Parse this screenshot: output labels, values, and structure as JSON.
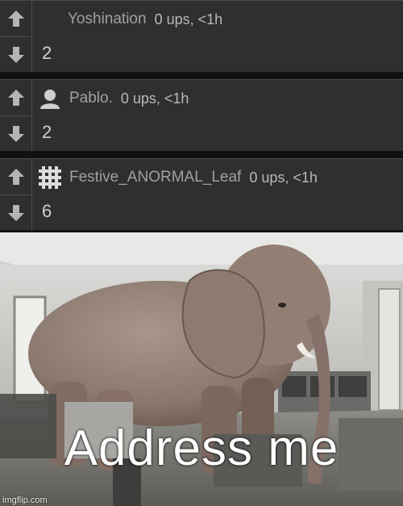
{
  "comments": [
    {
      "user": "Yoshination",
      "meta": "0 ups, <1h",
      "text": "2",
      "avatar": "none"
    },
    {
      "user": "Pablo.",
      "meta": "0 ups, <1h",
      "text": "2",
      "avatar": "default-person-icon"
    },
    {
      "user": "Festive_ANORMAL_Leaf",
      "meta": "0 ups, <1h",
      "text": "6",
      "avatar": "pixel-snowflake-icon"
    }
  ],
  "meme": {
    "caption": "Address me",
    "watermark": "imgflip.com"
  },
  "icons": {
    "upvote": "arrow-up-icon",
    "downvote": "arrow-down-icon"
  },
  "colors": {
    "panel": "#2f2f2f",
    "arrow": "#b5b5b5",
    "username": "#a0a0a0"
  }
}
